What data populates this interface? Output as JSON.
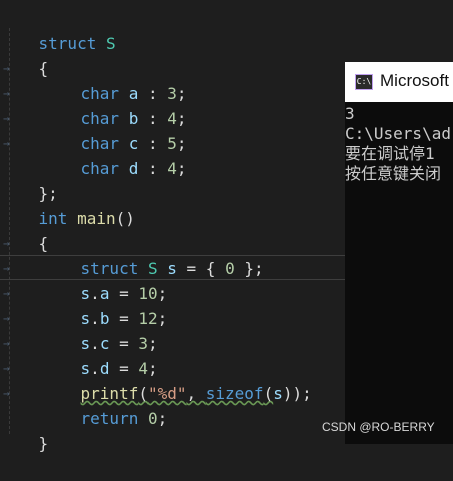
{
  "editor": {
    "lines": [
      {
        "t": [
          "struct ",
          "S"
        ]
      },
      {
        "t": [
          "{"
        ]
      },
      {
        "t": [
          "char",
          " ",
          "a",
          " : ",
          "3",
          ";"
        ]
      },
      {
        "t": [
          "char",
          " ",
          "b",
          " : ",
          "4",
          ";"
        ]
      },
      {
        "t": [
          "char",
          " ",
          "c",
          " : ",
          "5",
          ";"
        ]
      },
      {
        "t": [
          "char",
          " ",
          "d",
          " : ",
          "4",
          ";"
        ]
      },
      {
        "t": [
          "};"
        ]
      },
      {
        "t": [
          "int",
          " ",
          "main",
          "()"
        ]
      },
      {
        "t": [
          "{"
        ]
      },
      {
        "t": [
          "struct",
          " ",
          "S",
          " ",
          "s",
          " = { ",
          "0",
          " };"
        ]
      },
      {
        "t": [
          "s",
          ".",
          "a",
          " = ",
          "10",
          ";"
        ]
      },
      {
        "t": [
          "s",
          ".",
          "b",
          " = ",
          "12",
          ";"
        ]
      },
      {
        "t": [
          "s",
          ".",
          "c",
          " = ",
          "3",
          ";"
        ]
      },
      {
        "t": [
          "s",
          ".",
          "d",
          " = ",
          "4",
          ";"
        ]
      },
      {
        "t": [
          "printf",
          "(",
          "\"%d\"",
          ", ",
          "sizeof",
          "(",
          "s",
          "));"
        ]
      },
      {
        "t": [
          "return",
          " ",
          "0",
          ";"
        ]
      },
      {
        "t": [
          "}"
        ]
      }
    ]
  },
  "console": {
    "icon_text": "C:\\",
    "title": "Microsoft",
    "output": [
      "3",
      "C:\\Users\\ad",
      "要在调试停1",
      "按任意键关闭"
    ]
  },
  "watermark": "CSDN @RO-BERRY"
}
